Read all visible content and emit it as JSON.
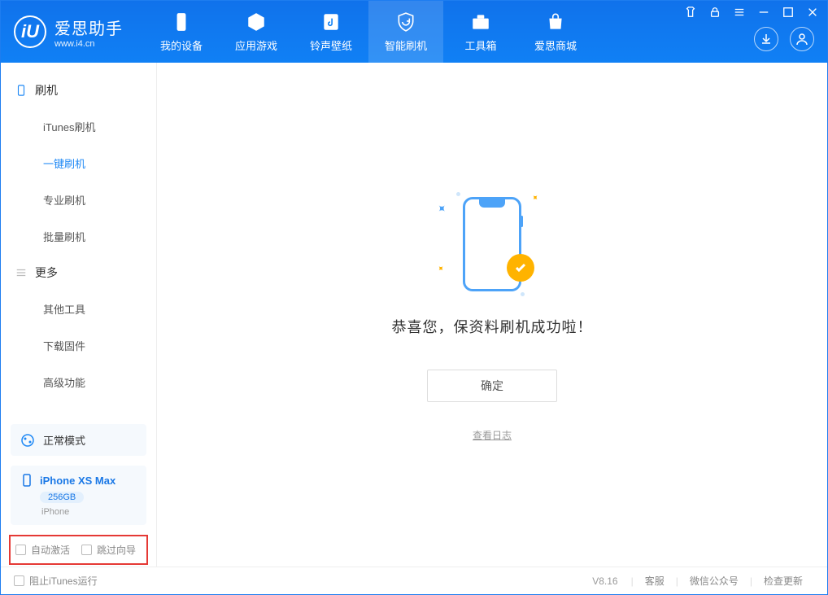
{
  "app": {
    "title": "爱思助手",
    "url": "www.i4.cn",
    "logo_letter": "iU"
  },
  "nav": {
    "items": [
      {
        "label": "我的设备"
      },
      {
        "label": "应用游戏"
      },
      {
        "label": "铃声壁纸"
      },
      {
        "label": "智能刷机"
      },
      {
        "label": "工具箱"
      },
      {
        "label": "爱思商城"
      }
    ]
  },
  "sidebar": {
    "group1_title": "刷机",
    "group1_items": [
      {
        "label": "iTunes刷机"
      },
      {
        "label": "一键刷机"
      },
      {
        "label": "专业刷机"
      },
      {
        "label": "批量刷机"
      }
    ],
    "group2_title": "更多",
    "group2_items": [
      {
        "label": "其他工具"
      },
      {
        "label": "下载固件"
      },
      {
        "label": "高级功能"
      }
    ],
    "mode_label": "正常模式",
    "device_name": "iPhone XS Max",
    "device_capacity": "256GB",
    "device_type": "iPhone",
    "opt_auto_activate": "自动激活",
    "opt_skip_guide": "跳过向导"
  },
  "main": {
    "success_message": "恭喜您，保资料刷机成功啦！",
    "ok_button": "确定",
    "view_log": "查看日志"
  },
  "statusbar": {
    "stop_itunes": "阻止iTunes运行",
    "version": "V8.16",
    "link_service": "客服",
    "link_wechat": "微信公众号",
    "link_update": "检查更新"
  }
}
